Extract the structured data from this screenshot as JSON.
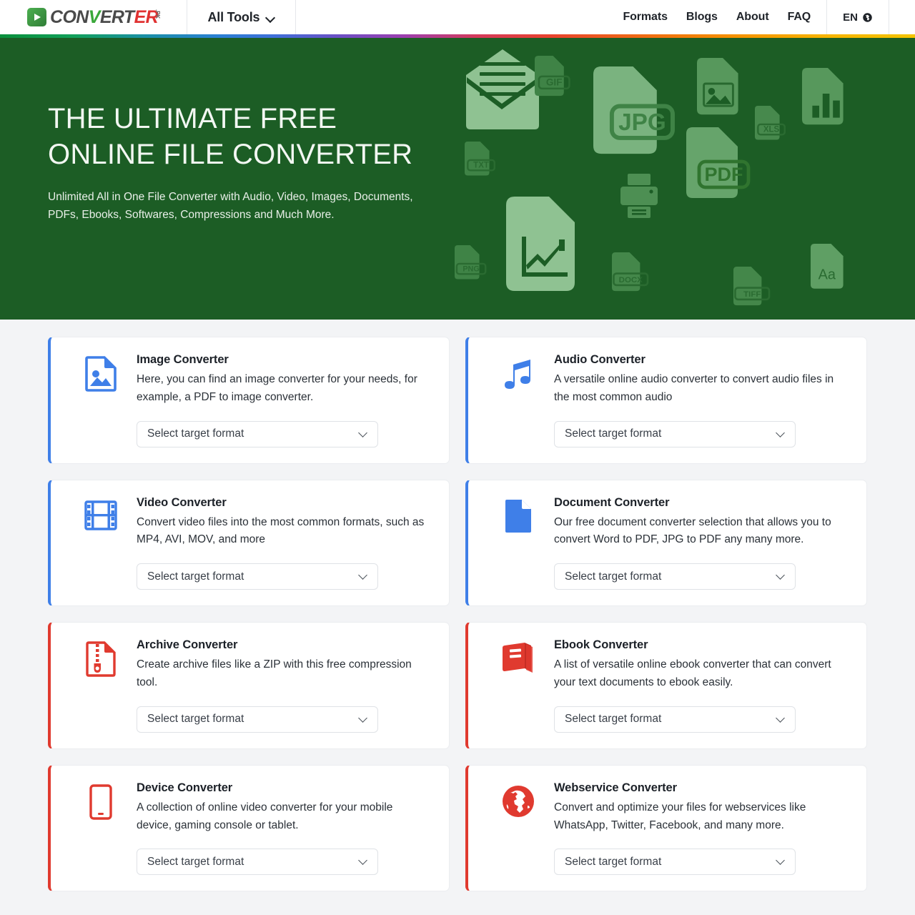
{
  "header": {
    "logo": {
      "icon": "play-button-icon",
      "part1": "CON",
      "part2": "V",
      "part3": "ERT",
      "part4": "ER",
      "suffix": ".PK"
    },
    "all_tools_label": "All Tools",
    "nav_links": [
      {
        "label": "Formats"
      },
      {
        "label": "Blogs"
      },
      {
        "label": "About"
      },
      {
        "label": "FAQ"
      }
    ],
    "language": {
      "label": "EN",
      "icon": "globe-icon"
    }
  },
  "hero": {
    "title_line1": "THE ULTIMATE FREE",
    "title_line2": "ONLINE FILE CONVERTER",
    "subtitle": "Unlimited All in One File Converter with Audio, Video, Images, Documents, PDFs, Ebooks, Softwares, Compressions and Much More.",
    "background_color": "#1c5d25",
    "art_labels": [
      "GIF",
      "JPG",
      "TXT",
      "XLS",
      "PDF",
      "PNG",
      "DOCX",
      "TIFF",
      "Aa"
    ]
  },
  "colors": {
    "blue_accent": "#3f7fe8",
    "red_accent": "#e03a2f",
    "hero_green": "#1c5d25",
    "logo_green": "#3aa83a",
    "logo_red": "#e03131"
  },
  "select_placeholder": "Select target format",
  "cards": [
    {
      "id": "image-converter",
      "icon": "image-file-icon",
      "accent": "blue",
      "title": "Image Converter",
      "description": "Here, you can find an image converter for your needs, for example, a PDF to image converter.",
      "select_label": "Select target format"
    },
    {
      "id": "audio-converter",
      "icon": "music-note-icon",
      "accent": "blue",
      "title": "Audio Converter",
      "description": "A versatile online audio converter to convert audio files in the most common audio",
      "select_label": "Select target format"
    },
    {
      "id": "video-converter",
      "icon": "film-strip-icon",
      "accent": "blue",
      "title": "Video Converter",
      "description": "Convert video files into the most common formats, such as MP4, AVI, MOV, and more",
      "select_label": "Select target format"
    },
    {
      "id": "document-converter",
      "icon": "document-page-icon",
      "accent": "blue",
      "title": "Document Converter",
      "description": "Our free document converter selection that allows you to convert Word to PDF, JPG to PDF any many more.",
      "select_label": "Select target format"
    },
    {
      "id": "archive-converter",
      "icon": "zip-archive-icon",
      "accent": "red",
      "title": "Archive Converter",
      "description": "Create archive files like a ZIP with this free compression tool.",
      "select_label": "Select target format"
    },
    {
      "id": "ebook-converter",
      "icon": "book-icon",
      "accent": "red",
      "title": "Ebook Converter",
      "description": "A list of versatile online ebook converter that can convert your text documents to ebook easily.",
      "select_label": "Select target format"
    },
    {
      "id": "device-converter",
      "icon": "mobile-device-icon",
      "accent": "red",
      "title": "Device Converter",
      "description": "A collection of online video converter for your mobile device, gaming console or tablet.",
      "select_label": "Select target format"
    },
    {
      "id": "webservice-converter",
      "icon": "globe-icon",
      "accent": "red",
      "title": "Webservice Converter",
      "description": "Convert and optimize your files for webservices like WhatsApp, Twitter, Facebook, and many more.",
      "select_label": "Select target format"
    }
  ]
}
